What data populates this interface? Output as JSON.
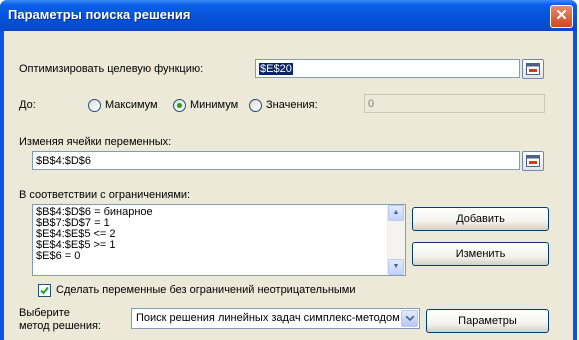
{
  "window": {
    "title": "Параметры поиска решения",
    "close_glyph": "✕"
  },
  "objective": {
    "label": "Оптимизировать целевую функцию:",
    "value": "$E$20"
  },
  "goal": {
    "label": "До:",
    "options": [
      {
        "label": "Максимум",
        "selected": false
      },
      {
        "label": "Минимум",
        "selected": true
      },
      {
        "label": "Значения:",
        "selected": false
      }
    ],
    "value_field": "0"
  },
  "variables": {
    "label": "Изменяя ячейки переменных:",
    "value": "$B$4:$D$6"
  },
  "constraints": {
    "label": "В соответствии с ограничениями:",
    "items": [
      "$B$4:$D$6 = бинарное",
      "$B$7:$D$7 = 1",
      "$E$4:$E$5 <= 2",
      "$E$4:$E$5 >= 1",
      "$E$6 = 0"
    ],
    "add_button": "Добавить",
    "change_button": "Изменить"
  },
  "nonnegative": {
    "label": "Сделать переменные без ограничений неотрицательными",
    "checked": true
  },
  "method": {
    "label_line1": "Выберите",
    "label_line2": "метод решения:",
    "selected": "Поиск решения линейных задач симплекс-методом",
    "options_button": "Параметры"
  },
  "colors": {
    "title_bar": "#0653d9",
    "dialog_bg": "#ece9d8",
    "selection": "#0a246a",
    "radio_dot": "#21a121"
  }
}
